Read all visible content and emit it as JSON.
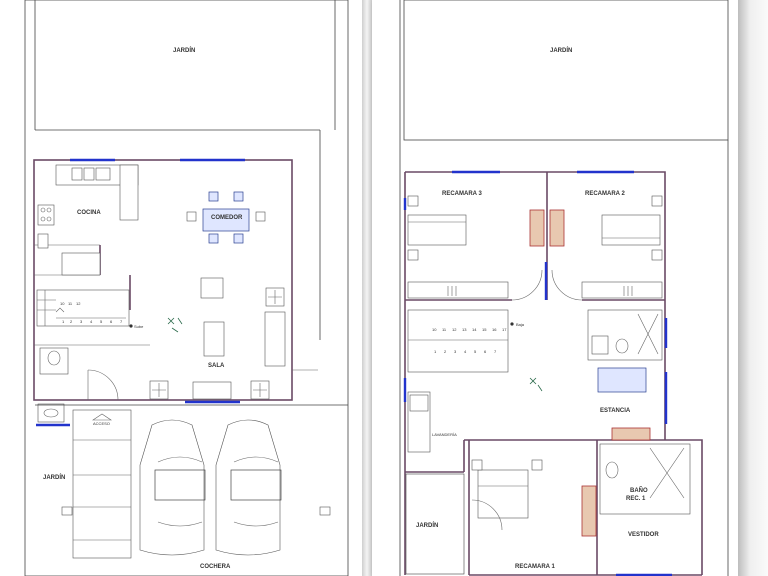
{
  "labels": {
    "jardin": "JARDÍN",
    "cocina": "COCINA",
    "comedor": "COMEDOR",
    "sala": "SALA",
    "cochera": "COCHERA",
    "acceso": "ACCESO",
    "recamara3": "RECAMARA 3",
    "recamara2": "RECAMARA 2",
    "recamara1": "RECAMARA 1",
    "estancia": "ESTANCIA",
    "bano_rec1": "BAÑO\nREC. 1",
    "bano_line1": "BAÑO",
    "bano_line2": "REC. 1",
    "vestidor": "VESTIDOR",
    "lavanderia": "LAVANDERÍA",
    "sube": "Sube",
    "baja": "Baja"
  },
  "stairs_ground": [
    "10",
    "11",
    "12",
    "1",
    "2",
    "3",
    "4",
    "5",
    "6",
    "7",
    "8",
    "9"
  ],
  "stairs_upper": [
    "10",
    "11",
    "12",
    "13",
    "14",
    "15",
    "16",
    "17",
    "1",
    "2",
    "3",
    "4",
    "5",
    "6",
    "7",
    "8",
    "9"
  ]
}
